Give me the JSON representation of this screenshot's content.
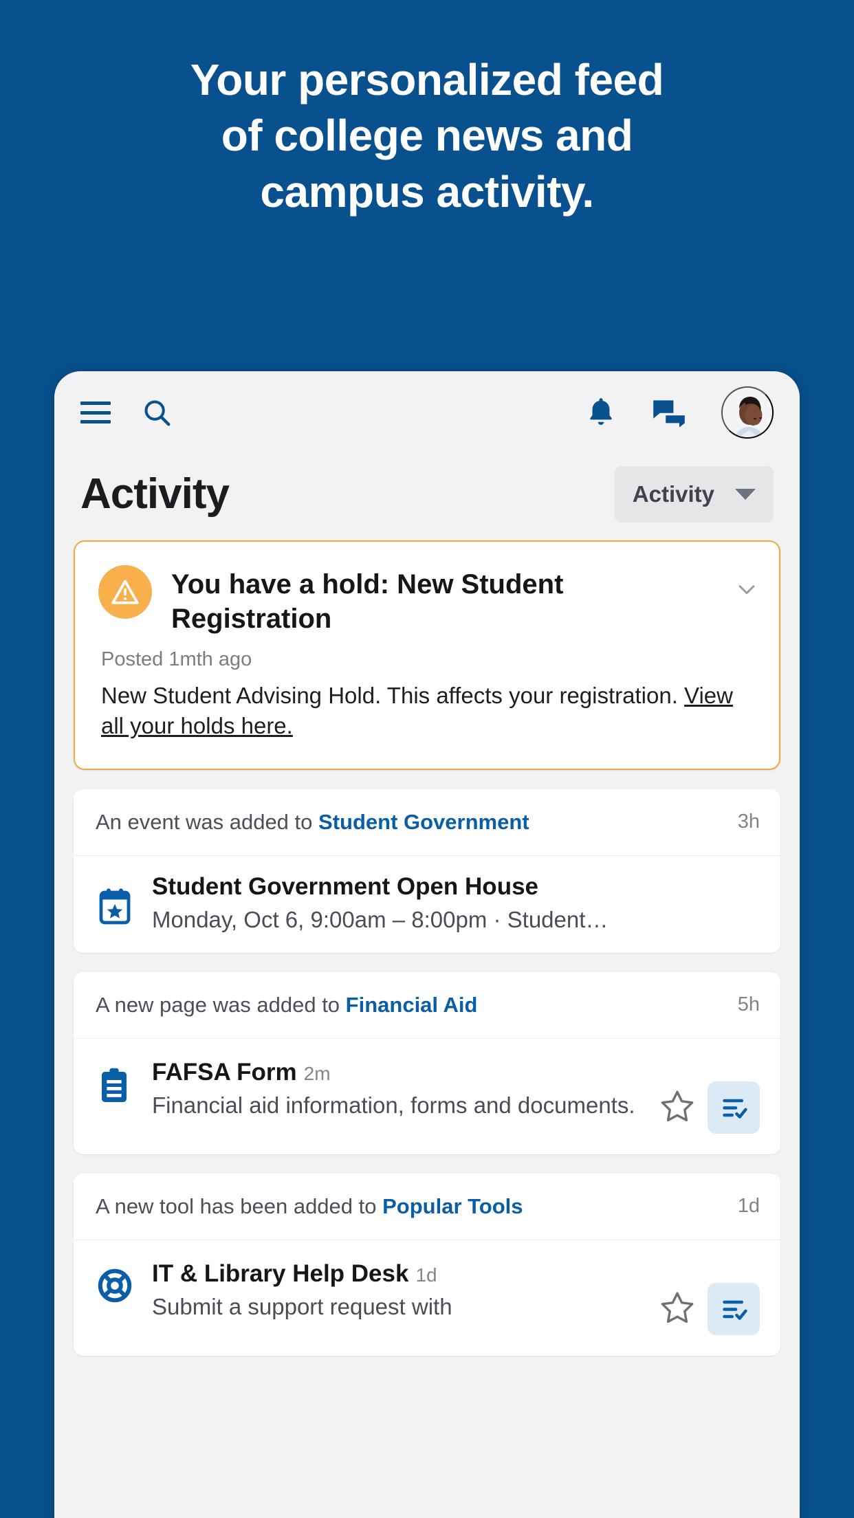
{
  "promo": {
    "headline_lines": [
      "Your personalized feed",
      "of college news and",
      "campus activity."
    ],
    "background_color": "#08518e"
  },
  "app": {
    "toolbar": {
      "menu_icon": "hamburger-menu-icon",
      "search_icon": "search-icon",
      "notifications_icon": "bell-icon",
      "messages_icon": "chat-bubbles-icon",
      "avatar_alt": "user-avatar"
    },
    "header": {
      "title": "Activity",
      "filter": {
        "label": "Activity",
        "caret_icon": "chevron-down-icon"
      }
    },
    "alert_card": {
      "icon": "warning-triangle-icon",
      "accent_color": "#f0a93a",
      "title": "You have a hold: New Student Registration",
      "expand_icon": "chevron-down-icon",
      "posted": "Posted 1mth ago",
      "body_text": "New Student Advising Hold. This affects your registration. ",
      "link_text": "View all your holds here."
    },
    "feed": [
      {
        "head_prefix": "An event was added to ",
        "head_link": "Student Government",
        "time": "3h",
        "icon": "calendar-star-icon",
        "title": "Student Government Open House",
        "title_time": "",
        "subtitle": "Monday, Oct 6, 9:00am – 8:00pm · Student…",
        "has_actions": false
      },
      {
        "head_prefix": "A new page was added to ",
        "head_link": "Financial Aid",
        "time": "5h",
        "icon": "clipboard-icon",
        "title": "FAFSA Form",
        "title_time": "2m",
        "subtitle": "Financial aid information, forms and documents.",
        "has_actions": true,
        "star_icon": "star-outline-icon",
        "list_icon": "checklist-icon"
      },
      {
        "head_prefix": "A new tool has been added to ",
        "head_link": "Popular Tools",
        "time": "1d",
        "icon": "lifebuoy-icon",
        "title": "IT & Library Help Desk",
        "title_time": "1d",
        "subtitle": "Submit a support request with",
        "has_actions": true,
        "star_icon": "star-outline-icon",
        "list_icon": "checklist-icon"
      }
    ]
  },
  "colors": {
    "brand_blue": "#08518e",
    "link_blue": "#0a5ea8",
    "alert_orange": "#f8b04c",
    "card_bg": "#ffffff",
    "app_bg": "#f2f2f2"
  }
}
